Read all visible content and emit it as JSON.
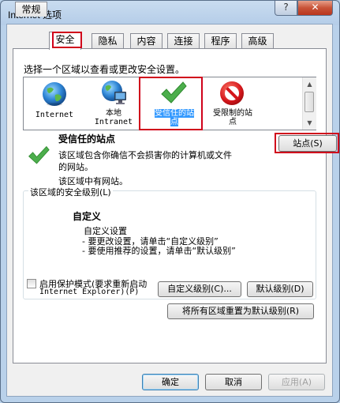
{
  "window": {
    "title": "Internet 选项",
    "help_label": "?",
    "close_label": "✕"
  },
  "tabs": [
    {
      "label": "常规"
    },
    {
      "label": "安全"
    },
    {
      "label": "隐私"
    },
    {
      "label": "内容"
    },
    {
      "label": "连接"
    },
    {
      "label": "程序"
    },
    {
      "label": "高级"
    }
  ],
  "security": {
    "instruction": "选择一个区域以查看或更改安全设置。",
    "zones": [
      {
        "line1": "Internet",
        "line2": "",
        "icon": "globe-icon"
      },
      {
        "line1": "本地",
        "line2": "Intranet",
        "icon": "local-intranet-icon"
      },
      {
        "line1": "受信任的站",
        "line2": "点",
        "icon": "checkmark-icon"
      },
      {
        "line1": "受限制的站",
        "line2": "点",
        "icon": "restricted-icon"
      }
    ],
    "zone_heading": "受信任的站点",
    "zone_desc_line1": "该区域包含你确信不会损害你的计算机或文件",
    "zone_desc_line2": "的网站。",
    "zone_has_sites": "该区域中有网站。",
    "sites_button": "站点(S)",
    "level_group_label": "该区域的安全级别(L)",
    "level_title": "自定义",
    "level_line1": "自定义设置",
    "level_line2": "- 要更改设置，请单击“自定义级别”",
    "level_line3": "- 要使用推荐的设置，请单击“默认级别”",
    "protected_mode_line1": "启用保护模式(要求重新启动",
    "protected_mode_line2": "Internet Explorer)(P)",
    "protected_mode_checked": false,
    "custom_level_button": "自定义级别(C)...",
    "default_level_button": "默认级别(D)",
    "reset_all_button": "将所有区域重置为默认级别(R)"
  },
  "footer": {
    "ok": "确定",
    "cancel": "取消",
    "apply": "应用(A)"
  },
  "colors": {
    "highlight": "#d0021b",
    "selection": "#3399ff",
    "check_green": "#3aa83a"
  }
}
